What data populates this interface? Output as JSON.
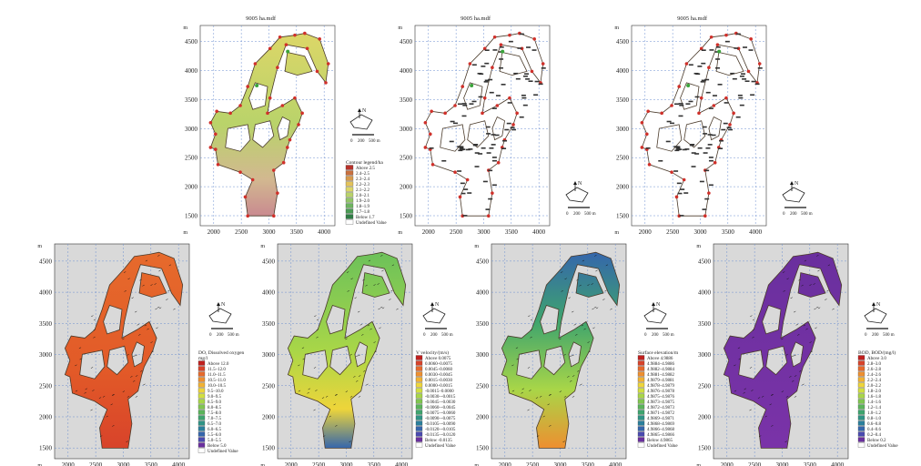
{
  "figure": {
    "top_panel_title": "9005 ha.mdf",
    "axis_unit": "m",
    "x_ticks": [
      "2000",
      "2500",
      "3000",
      "3500",
      "4000"
    ],
    "y_ticks": [
      "4500",
      "4000",
      "3500",
      "3000",
      "2500",
      "2000",
      "1500"
    ],
    "x_ticks_bottom": [
      "2000",
      "2500",
      "3000",
      "3500",
      "4000"
    ],
    "y_ticks_bottom": [
      "4500",
      "4000",
      "3500",
      "3000",
      "2500",
      "2000",
      "1500"
    ]
  },
  "north_arrow": {
    "label": "N",
    "scale_labels": [
      "0",
      "200",
      "500 m"
    ]
  },
  "legends": {
    "top1": {
      "title": "Contour legend/ha",
      "entries": [
        "Above 2.5",
        "2.4–2.5",
        "2.3–2.4",
        "2.2–2.3",
        "2.1–2.2",
        "2.0–2.1",
        "1.9–2.0",
        "1.8–1.9",
        "1.7–1.8",
        "Below 1.7",
        "Undefined Value"
      ],
      "colors": [
        "#b8322a",
        "#c9703e",
        "#d79a4c",
        "#e3c25a",
        "#dcd668",
        "#b9d36a",
        "#93c668",
        "#6db45f",
        "#4a9b54",
        "#2f7d45",
        "#ffffff"
      ]
    },
    "bottom1": {
      "title": "DO, Dissolved oxygen",
      "unit": "mg/l",
      "entries": [
        "Above 12.0",
        "11.5–12.0",
        "11.0–11.5",
        "10.5–11.0",
        "10.0–10.5",
        "9.5–10.0",
        "9.0–9.5",
        "8.5–9.0",
        "8.0–8.5",
        "7.5–8.0",
        "7.0–7.5",
        "6.5–7.0",
        "6.0–6.5",
        "5.5–6.0",
        "5.0–5.5",
        "Below 5.0",
        "Undefined Value"
      ],
      "colors": [
        "#c0201e",
        "#d8432a",
        "#e66a2c",
        "#ee8f30",
        "#f2b233",
        "#eed53a",
        "#d2e040",
        "#a8d648",
        "#80c650",
        "#5ab45a",
        "#3ea46e",
        "#2f9486",
        "#2a7f9c",
        "#3566ac",
        "#4a4ab0",
        "#6a2f9e",
        "#ffffff"
      ]
    },
    "bottom2": {
      "title": "V velocity/(m/s)",
      "entries": [
        "Above 0.0075",
        "0.0060–0.0075",
        "0.0045–0.0060",
        "0.0030–0.0045",
        "0.0015–0.0030",
        "0.0000–0.0015",
        "-0.0015–0.0000",
        "-0.0030–-0.0015",
        "-0.0045–-0.0030",
        "-0.0060–-0.0045",
        "-0.0075–-0.0060",
        "-0.0090–-0.0075",
        "-0.0105–-0.0090",
        "-0.0120–-0.0105",
        "-0.0135–-0.0120",
        "Below -0.0135",
        "Undefined Value"
      ],
      "colors": [
        "#c0201e",
        "#d8432a",
        "#e66a2c",
        "#ee8f30",
        "#f2b233",
        "#eed53a",
        "#d2e040",
        "#a8d648",
        "#80c650",
        "#5ab45a",
        "#3ea46e",
        "#2f9486",
        "#2a7f9c",
        "#3566ac",
        "#4a4ab0",
        "#6a2f9e",
        "#ffffff"
      ]
    },
    "bottom3": {
      "title": "Surface elevation/m",
      "entries": [
        "Above 4.9886",
        "4.9884–4.9886",
        "4.9882–4.9884",
        "4.9881–4.9882",
        "4.9879–4.9881",
        "4.9878–4.9879",
        "4.9876–4.9878",
        "4.9875–4.9876",
        "4.9873–4.9875",
        "4.9872–4.9873",
        "4.9871–4.9872",
        "4.9869–4.9871",
        "4.9868–4.9869",
        "4.9866–4.9868",
        "4.9865–4.9866",
        "Below 4.9865",
        "Undefined Value"
      ],
      "colors": [
        "#c0201e",
        "#d8432a",
        "#e66a2c",
        "#ee8f30",
        "#f2b233",
        "#eed53a",
        "#d2e040",
        "#a8d648",
        "#80c650",
        "#5ab45a",
        "#3ea46e",
        "#2f9486",
        "#2a7f9c",
        "#3566ac",
        "#4a4ab0",
        "#6a2f9e",
        "#ffffff"
      ]
    },
    "bottom4": {
      "title": "BOD, BOD/(mg/l)",
      "entries": [
        "Above 3.0",
        "2.8–3.0",
        "2.6–2.8",
        "2.4–2.6",
        "2.2–2.4",
        "2.0–2.2",
        "1.8–2.0",
        "1.6–1.8",
        "1.4–1.6",
        "1.2–1.4",
        "1.0–1.2",
        "0.8–1.0",
        "0.6–0.8",
        "0.4–0.6",
        "0.2–0.4",
        "Below 0.2",
        "Undefined Value"
      ],
      "colors": [
        "#c0201e",
        "#d8432a",
        "#e66a2c",
        "#ee8f30",
        "#f2b233",
        "#eed53a",
        "#d2e040",
        "#a8d648",
        "#80c650",
        "#5ab45a",
        "#3ea46e",
        "#2f9486",
        "#2a7f9c",
        "#3566ac",
        "#4a4ab0",
        "#6a2f9e",
        "#ffffff"
      ]
    }
  },
  "chart_data": [
    {
      "type": "heatmap",
      "panel": "top-1",
      "title": "9005 ha.mdf",
      "xlim": [
        1800,
        4100
      ],
      "ylim": [
        1200,
        4800
      ],
      "legend": "Contour legend/ha",
      "grid": true
    },
    {
      "type": "heatmap",
      "panel": "top-2",
      "title": "9005 ha.mdf",
      "xlim": [
        1800,
        4100
      ],
      "ylim": [
        1200,
        4800
      ],
      "grid": true
    },
    {
      "type": "heatmap",
      "panel": "top-3",
      "title": "9005 ha.mdf",
      "xlim": [
        1800,
        4100
      ],
      "ylim": [
        1200,
        4800
      ],
      "grid": true
    },
    {
      "type": "heatmap",
      "panel": "bottom-1",
      "xlim": [
        1700,
        4100
      ],
      "ylim": [
        1200,
        4800
      ],
      "legend": "DO, Dissolved oxygen",
      "dominant_range": "11.0–12.0",
      "grid": true
    },
    {
      "type": "heatmap",
      "panel": "bottom-2",
      "xlim": [
        1700,
        4100
      ],
      "ylim": [
        1200,
        4800
      ],
      "legend": "V velocity/(m/s)",
      "grid": true
    },
    {
      "type": "heatmap",
      "panel": "bottom-3",
      "xlim": [
        1700,
        4100
      ],
      "ylim": [
        1200,
        4800
      ],
      "legend": "Surface elevation/m",
      "grid": true
    },
    {
      "type": "heatmap",
      "panel": "bottom-4",
      "xlim": [
        1700,
        4100
      ],
      "ylim": [
        1200,
        4800
      ],
      "legend": "BOD, BOD/(mg/l)",
      "dominant_range": "Below 0.2",
      "grid": true
    }
  ]
}
